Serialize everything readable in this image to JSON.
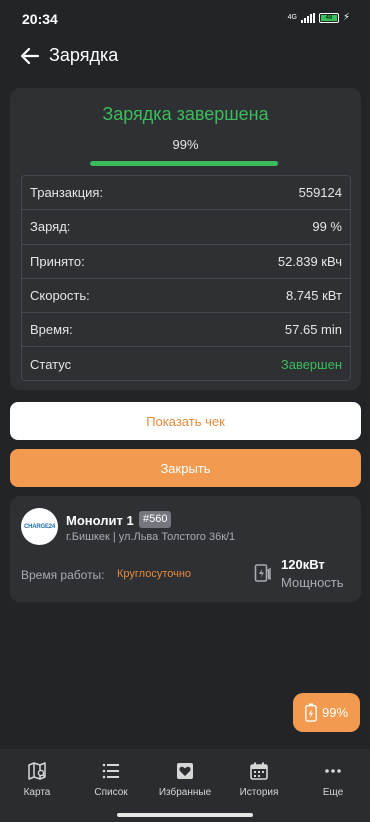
{
  "status_bar": {
    "time": "20:34",
    "network": "4G",
    "battery_icon_label": "48"
  },
  "header": {
    "back_icon": "arrow-left-icon",
    "title": "Зарядка"
  },
  "charge": {
    "title": "Зарядка завершена",
    "percent_text": "99%",
    "progress": 99,
    "accent_color": "#3bbd5c"
  },
  "details": [
    {
      "label": "Транзакция:",
      "value": "559124"
    },
    {
      "label": "Заряд:",
      "value": "99 %"
    },
    {
      "label": "Принято:",
      "value": "52.839 кВч"
    },
    {
      "label": "Скорость:",
      "value": "8.745 кВт"
    },
    {
      "label": "Время:",
      "value": "57.65 min"
    },
    {
      "label": "Статус",
      "value": "Завершен"
    }
  ],
  "buttons": {
    "receipt": "Показать чек",
    "close": "Закрыть"
  },
  "station": {
    "logo_text": "CHARGE24",
    "name": "Монолит 1",
    "number": "#560",
    "address": "г.Бишкек | ул.Льва Толстого 36к/1",
    "hours_label": "Время работы:",
    "hours_value": "Круглосуточно",
    "power_value": "120кВт",
    "power_label": "Мощность",
    "power_icon": "charging-station-icon"
  },
  "floating": {
    "icon": "battery-charging-icon",
    "text": "99%"
  },
  "nav": [
    {
      "label": "Карта",
      "icon": "map-icon"
    },
    {
      "label": "Список",
      "icon": "list-icon"
    },
    {
      "label": "Избранные",
      "icon": "heart-icon"
    },
    {
      "label": "История",
      "icon": "calendar-icon"
    },
    {
      "label": "Еще",
      "icon": "more-icon"
    }
  ],
  "colors": {
    "background": "#222428",
    "card": "#2e3034",
    "orange": "#f29a4f",
    "green": "#3bbd5c"
  }
}
